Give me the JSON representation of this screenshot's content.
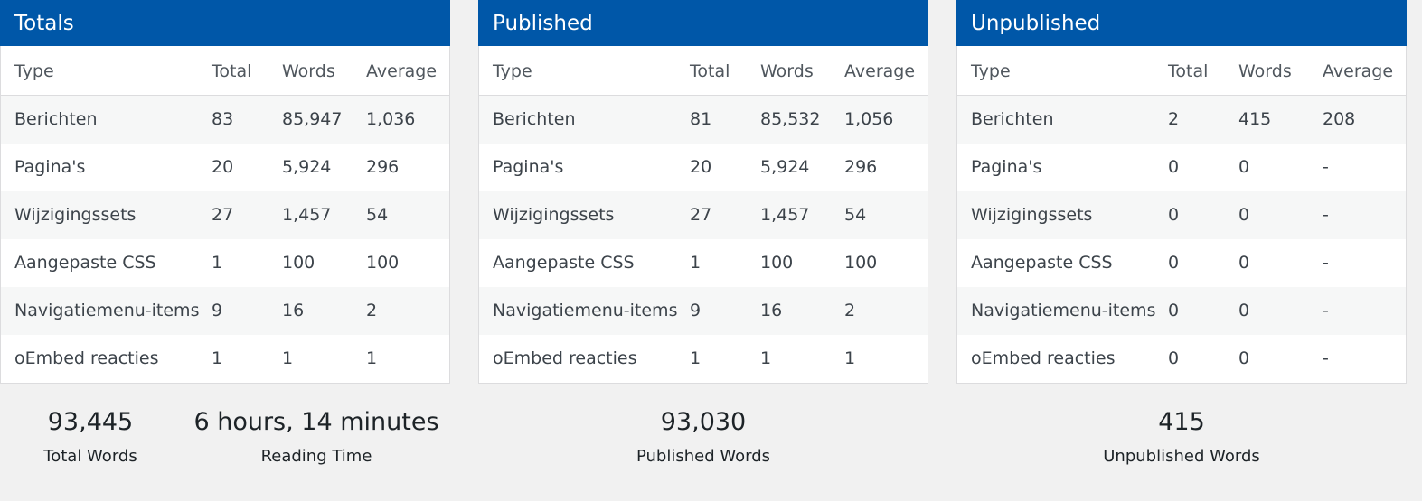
{
  "columns": {
    "type": "Type",
    "total": "Total",
    "words": "Words",
    "average": "Average"
  },
  "panels": [
    {
      "title": "Totals",
      "rows": [
        {
          "type": "Berichten",
          "total": "83",
          "words": "85,947",
          "average": "1,036"
        },
        {
          "type": "Pagina's",
          "total": "20",
          "words": "5,924",
          "average": "296"
        },
        {
          "type": "Wijzigingssets",
          "total": "27",
          "words": "1,457",
          "average": "54"
        },
        {
          "type": "Aangepaste CSS",
          "total": "1",
          "words": "100",
          "average": "100"
        },
        {
          "type": "Navigatiemenu-items",
          "total": "9",
          "words": "16",
          "average": "2"
        },
        {
          "type": "oEmbed reacties",
          "total": "1",
          "words": "1",
          "average": "1"
        }
      ]
    },
    {
      "title": "Published",
      "rows": [
        {
          "type": "Berichten",
          "total": "81",
          "words": "85,532",
          "average": "1,056"
        },
        {
          "type": "Pagina's",
          "total": "20",
          "words": "5,924",
          "average": "296"
        },
        {
          "type": "Wijzigingssets",
          "total": "27",
          "words": "1,457",
          "average": "54"
        },
        {
          "type": "Aangepaste CSS",
          "total": "1",
          "words": "100",
          "average": "100"
        },
        {
          "type": "Navigatiemenu-items",
          "total": "9",
          "words": "16",
          "average": "2"
        },
        {
          "type": "oEmbed reacties",
          "total": "1",
          "words": "1",
          "average": "1"
        }
      ]
    },
    {
      "title": "Unpublished",
      "rows": [
        {
          "type": "Berichten",
          "total": "2",
          "words": "415",
          "average": "208"
        },
        {
          "type": "Pagina's",
          "total": "0",
          "words": "0",
          "average": "-"
        },
        {
          "type": "Wijzigingssets",
          "total": "0",
          "words": "0",
          "average": "-"
        },
        {
          "type": "Aangepaste CSS",
          "total": "0",
          "words": "0",
          "average": "-"
        },
        {
          "type": "Navigatiemenu-items",
          "total": "0",
          "words": "0",
          "average": "-"
        },
        {
          "type": "oEmbed reacties",
          "total": "0",
          "words": "0",
          "average": "-"
        }
      ]
    }
  ],
  "stats": {
    "total_words": {
      "value": "93,445",
      "label": "Total Words"
    },
    "reading_time": {
      "value": "6 hours, 14 minutes",
      "label": "Reading Time"
    },
    "published_words": {
      "value": "93,030",
      "label": "Published Words"
    },
    "unpublished_words": {
      "value": "415",
      "label": "Unpublished Words"
    }
  },
  "colors": {
    "header_bg": "#0057a8",
    "page_bg": "#f1f1f1",
    "alt_row_bg": "#f6f7f7"
  }
}
